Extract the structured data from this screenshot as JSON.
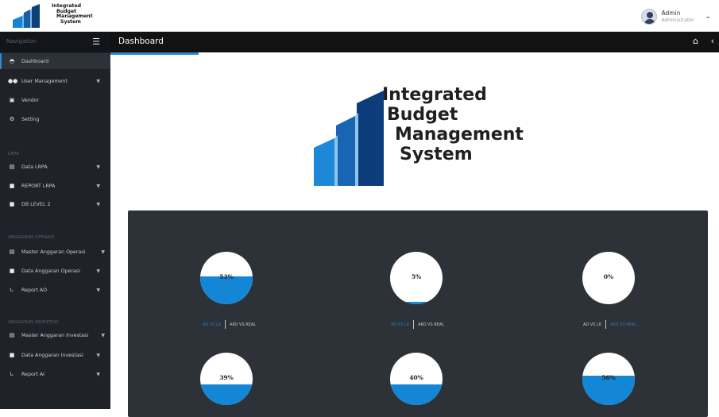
{
  "brand": {
    "logo_lines": [
      "Integrated",
      "Budget",
      "Management",
      "System"
    ],
    "accent_color": "#1386d6"
  },
  "user": {
    "name": "Admin",
    "role": "Administrator",
    "avatar_icon": "user-avatar-icon",
    "caret_icon": "chevron-down-icon"
  },
  "sidebar": {
    "header": "Navigation",
    "menu_icon": "hamburger-icon",
    "items": [
      {
        "label": "Dashboard",
        "icon": "dashboard-icon",
        "active": true
      },
      {
        "label": "User Management",
        "icon": "users-icon",
        "has_caret": true
      },
      {
        "label": "Vendor",
        "icon": "vendor-icon"
      },
      {
        "label": "Setting",
        "icon": "gear-icon"
      }
    ],
    "sections": [
      {
        "title": "LRPA",
        "items": [
          {
            "label": "Data LRPA",
            "icon": "table-icon",
            "has_caret": true
          },
          {
            "label": "REPORT LRPA",
            "icon": "document-icon",
            "has_caret": true
          },
          {
            "label": "DB LEVEL 2",
            "icon": "document-icon",
            "has_caret": true
          }
        ]
      },
      {
        "title": "ANGGARAN OPERASI",
        "items": [
          {
            "label": "Master Anggaran Operasi",
            "icon": "table-icon",
            "has_caret": true
          },
          {
            "label": "Data Anggaran Operasi",
            "icon": "document-icon",
            "has_caret": true
          },
          {
            "label": "Report AO",
            "icon": "chart-icon",
            "has_caret": true
          }
        ]
      },
      {
        "title": "ANGGARAN INVESTASI",
        "items": [
          {
            "label": "Master Anggaran Investasi",
            "icon": "table-icon",
            "has_caret": true
          },
          {
            "label": "Data Anggaran Investasi",
            "icon": "document-icon",
            "has_caret": true
          },
          {
            "label": "Report AI",
            "icon": "chart-icon",
            "has_caret": true
          }
        ]
      }
    ]
  },
  "header": {
    "title": "Dashboard",
    "home_icon": "home-icon",
    "back_icon": "chevron-left-icon"
  },
  "gauges": [
    {
      "label": "53%",
      "fraction": 0.53,
      "tab_left": "AO VS LK",
      "tab_right": "AKO VS REAL",
      "active_tab": "left"
    },
    {
      "label": "5%",
      "fraction": 0.05,
      "tab_left": "AO VS LK",
      "tab_right": "AKO VS REAL",
      "active_tab": "left"
    },
    {
      "label": "0%",
      "fraction": 0.0,
      "tab_left": "AO VS LK",
      "tab_right": "AKO VS REAL",
      "active_tab": "right"
    },
    {
      "label": "39%",
      "fraction": 0.39
    },
    {
      "label": "40%",
      "fraction": 0.4
    },
    {
      "label": "56%",
      "fraction": 0.56
    }
  ]
}
